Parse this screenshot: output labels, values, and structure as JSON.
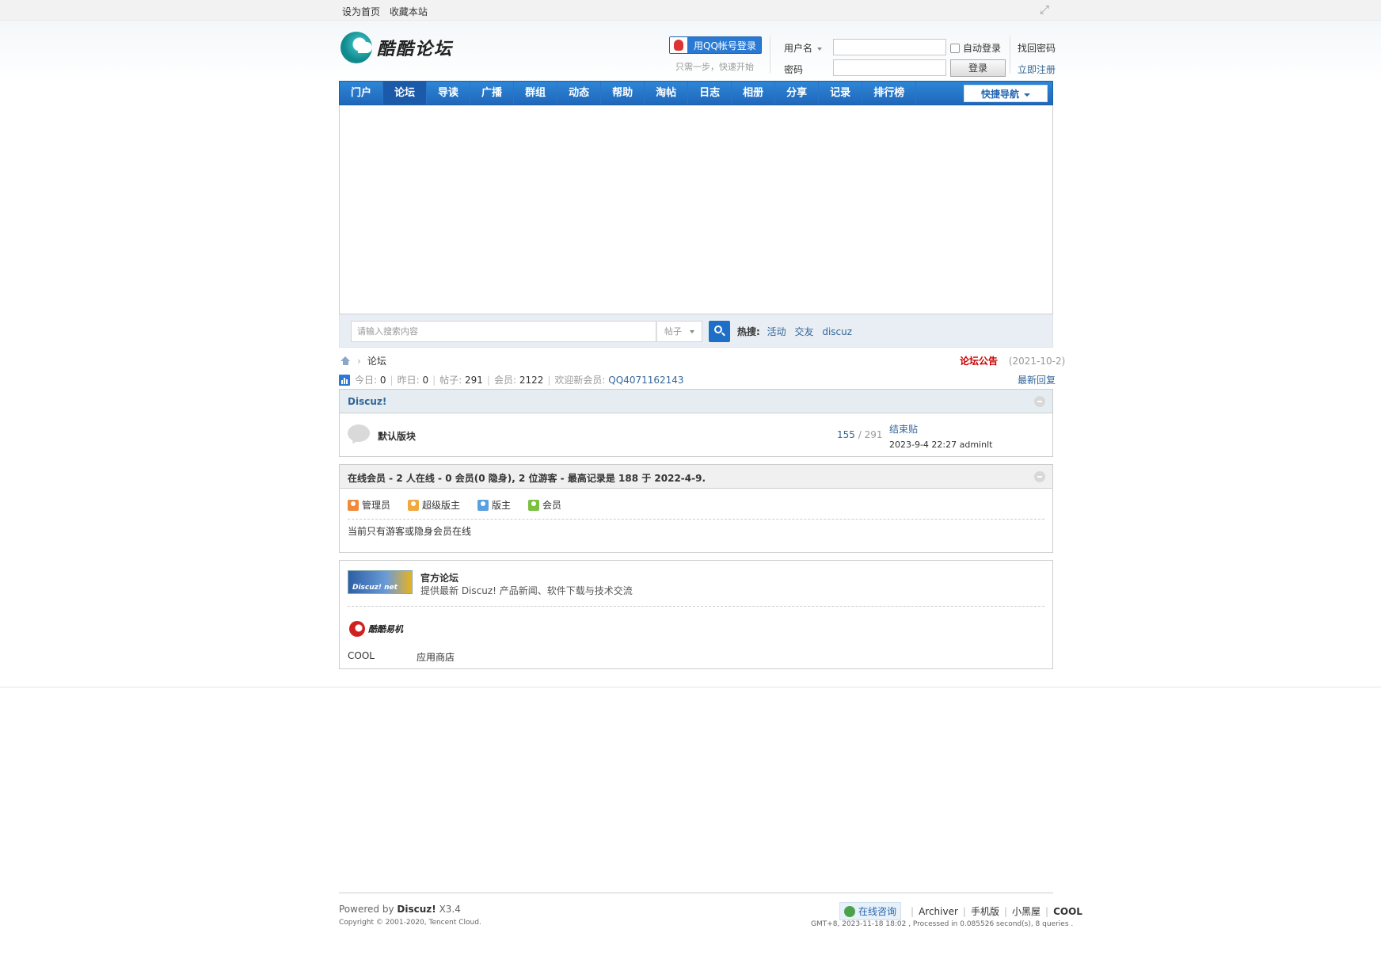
{
  "topbar": {
    "links": [
      "设为首页",
      "收藏本站"
    ],
    "expand_icon": "fullscreen-icon"
  },
  "logo": {
    "text": "酷酷论坛"
  },
  "login": {
    "qq_button": "用QQ帐号登录",
    "qq_hint": "只需一步，快速开始",
    "username_label": "用户名",
    "password_label": "密码",
    "auto_login": "自动登录",
    "login_button": "登录",
    "find_password": "找回密码",
    "register": "立即注册"
  },
  "nav": {
    "items": [
      "门户",
      "论坛",
      "导读",
      "广播",
      "群组",
      "动态",
      "帮助",
      "淘帖",
      "日志",
      "相册",
      "分享",
      "记录",
      "排行榜"
    ],
    "active_index": 1,
    "quick_nav": "快捷导航"
  },
  "search": {
    "placeholder": "请输入搜索内容",
    "type": "帖子",
    "hot_label": "热搜:",
    "hot_terms": [
      "活动",
      "交友",
      "discuz"
    ]
  },
  "breadcrumb": {
    "current": "论坛"
  },
  "announcement": {
    "title": "论坛公告",
    "date": "(2021-10-2)"
  },
  "stats": {
    "today_label": "今日:",
    "today": "0",
    "yesterday_label": "昨日:",
    "yesterday": "0",
    "posts_label": "帖子:",
    "posts": "291",
    "members_label": "会员:",
    "members": "2122",
    "newest_label": "欢迎新会员:",
    "newest": "QQ4071162143",
    "latest_reply": "最新回复"
  },
  "forum_group": {
    "title": "Discuz!",
    "forums": [
      {
        "name": "默认版块",
        "threads": "155",
        "posts": "291",
        "last_title": "结束贴",
        "last_meta": "2023-9-4 22:27 adminlt"
      }
    ]
  },
  "online": {
    "title": "在线会员 - 2 人在线 - 0 会员(0 隐身), 2 位游客 - 最高记录是 188 于 2022-4-9.",
    "legend": [
      {
        "label": "管理员",
        "color": "#f08a3a"
      },
      {
        "label": "超级版主",
        "color": "#f0a840"
      },
      {
        "label": "版主",
        "color": "#58a0e0"
      },
      {
        "label": "会员",
        "color": "#7cc040"
      }
    ],
    "message": "当前只有游客或隐身会员在线"
  },
  "links": {
    "official_title": "官方论坛",
    "official_desc": "提供最新 Discuz! 产品新闻、软件下载与技术交流",
    "official_logo_text": "Discuz! net",
    "cool_logo_text": "酷酷易机",
    "text_links": [
      "COOL",
      "应用商店"
    ]
  },
  "footer": {
    "powered_prefix": "Powered by",
    "powered_name": "Discuz!",
    "powered_version": "X3.4",
    "copyright": "Copyright © 2001-2020, Tencent Cloud.",
    "consult": "在线咨询",
    "links": [
      "Archiver",
      "手机版",
      "小黑屋"
    ],
    "brand": "COOL",
    "gmt": "GMT+8, 2023-11-18 18:02 , Processed in 0.085526 second(s), 8 queries ."
  }
}
